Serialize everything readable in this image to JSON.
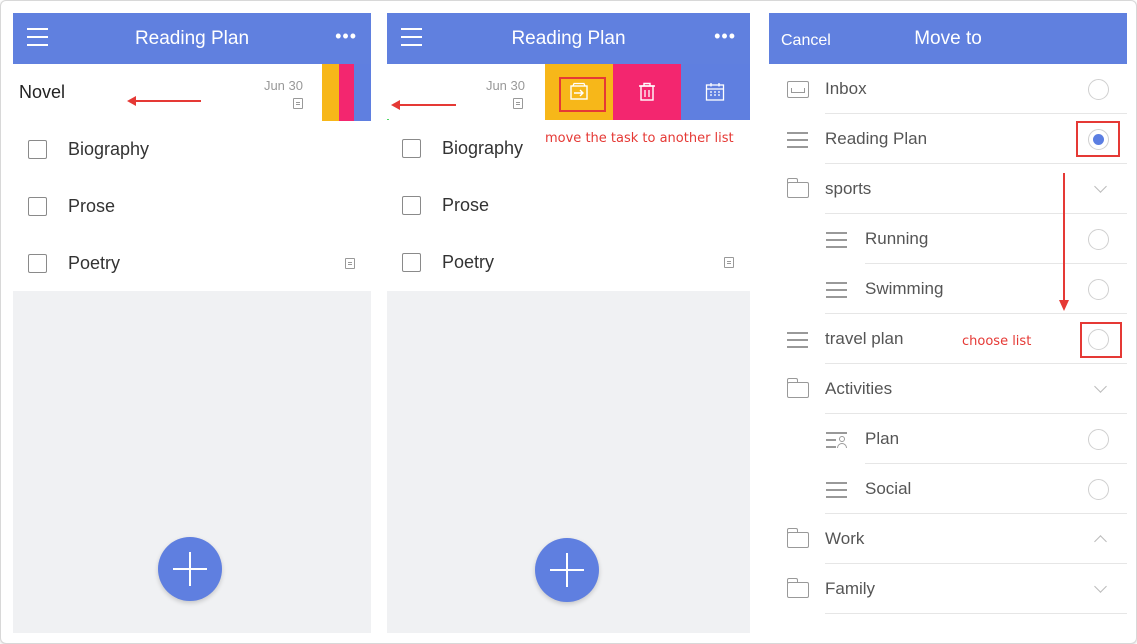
{
  "panel1": {
    "title": "Reading Plan",
    "more": "•••",
    "swiped_task": {
      "label": "Novel",
      "date": "Jun 30"
    },
    "tasks": [
      {
        "label": "Biography"
      },
      {
        "label": "Prose"
      },
      {
        "label": "Poetry"
      }
    ]
  },
  "panel2": {
    "title": "Reading Plan",
    "more": "•••",
    "swiped_task": {
      "date": "Jun 30"
    },
    "tasks": [
      {
        "label": "Biography"
      },
      {
        "label": "Prose"
      },
      {
        "label": "Poetry"
      }
    ],
    "annotation": "move the task to another list"
  },
  "panel3": {
    "cancel": "Cancel",
    "title": "Move to",
    "annotation": "choose list",
    "items": [
      {
        "label": "Inbox"
      },
      {
        "label": "Reading Plan"
      },
      {
        "label": "sports"
      },
      {
        "label": "Running"
      },
      {
        "label": "Swimming"
      },
      {
        "label": "travel plan"
      },
      {
        "label": "Activities"
      },
      {
        "label": "Plan"
      },
      {
        "label": "Social"
      },
      {
        "label": "Work"
      },
      {
        "label": "Family"
      }
    ]
  },
  "colors": {
    "header": "#6080df",
    "move_action": "#f7b719",
    "delete_action": "#f3266f",
    "schedule_action": "#5f7fe0",
    "annotation": "#e53935",
    "selected_radio": "#5b7ee2",
    "indicator": "#4cd964"
  },
  "icons": {
    "menu": "hamburger-icon",
    "more": "more-icon",
    "move": "move-to-list-icon",
    "delete": "trash-icon",
    "schedule": "calendar-icon",
    "add": "plus-icon"
  }
}
